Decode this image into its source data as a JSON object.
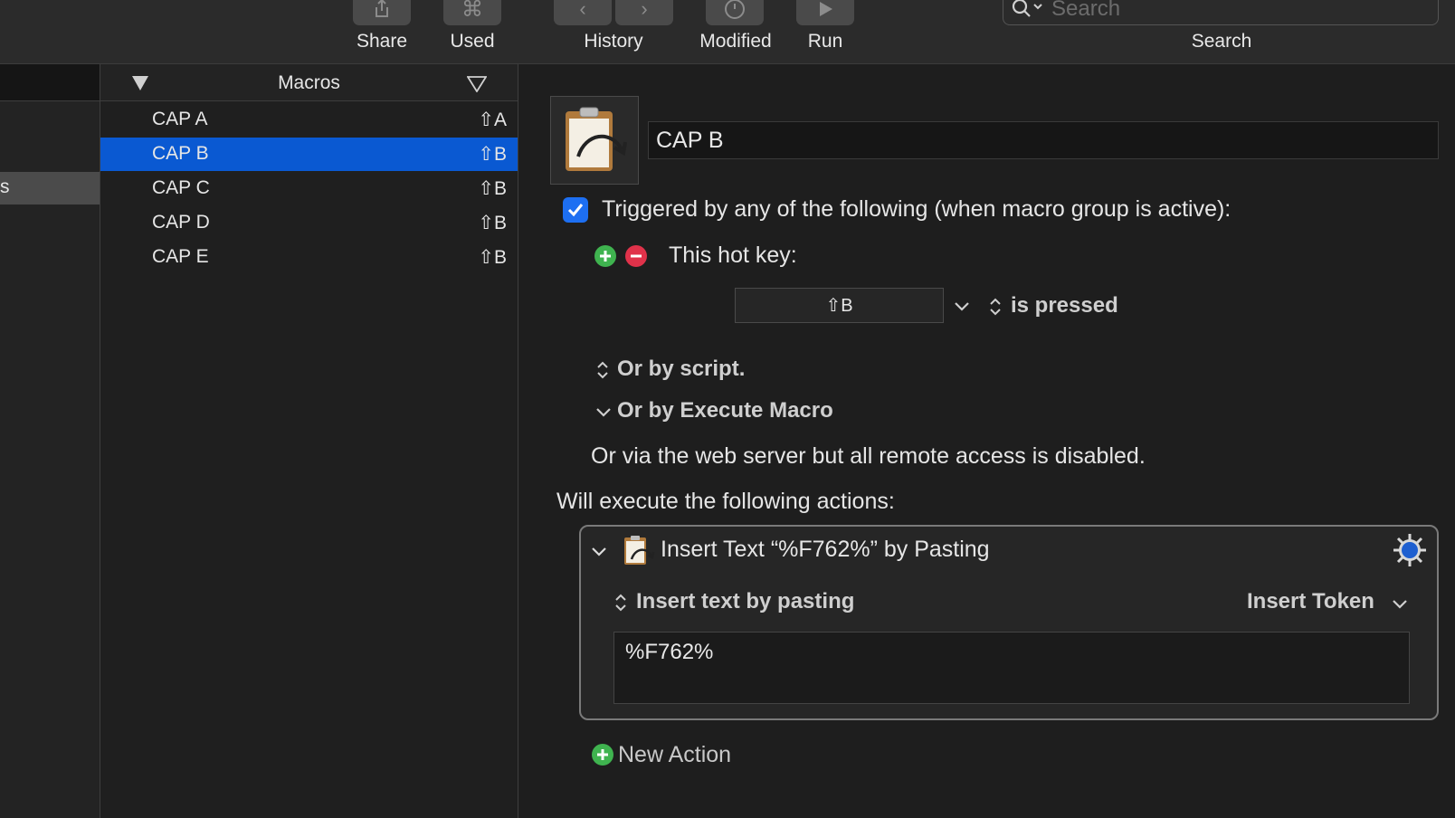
{
  "toolbar": {
    "share_label": "Share",
    "used_label": "Used",
    "history_label": "History",
    "modified_label": "Modified",
    "run_label": "Run",
    "search_label": "Search",
    "search_placeholder": "Search"
  },
  "groups": {
    "selected_label_fragment": "s"
  },
  "macros": {
    "header": "Macros",
    "items": [
      {
        "name": "CAP A",
        "key": "⇧A"
      },
      {
        "name": "CAP B",
        "key": "⇧B"
      },
      {
        "name": "CAP C",
        "key": "⇧B"
      },
      {
        "name": "CAP D",
        "key": "⇧B"
      },
      {
        "name": "CAP E",
        "key": "⇧B"
      }
    ],
    "selected_index": 1
  },
  "editor": {
    "macro_name": "CAP B",
    "trigger_label": "Triggered by any of the following (when macro group is active):",
    "trigger_checked": true,
    "hotkey_title": "This hot key:",
    "hotkey_value": "⇧B",
    "hotkey_condition": "is pressed",
    "or_script": "Or by script.",
    "or_execute": "Or by Execute Macro",
    "web_server_note": "Or via the web server but all remote access is disabled.",
    "actions_heading": "Will execute the following actions:",
    "action": {
      "title": "Insert Text “%F762%” by Pasting",
      "mode_label": "Insert text by pasting",
      "token_menu": "Insert Token",
      "text_value": "%F762%"
    },
    "new_action_label": "New Action"
  },
  "colors": {
    "selection_blue": "#0a59d2",
    "checkbox_blue": "#1d6ff2",
    "add_green": "#3fb34f",
    "remove_red": "#e0324a"
  }
}
